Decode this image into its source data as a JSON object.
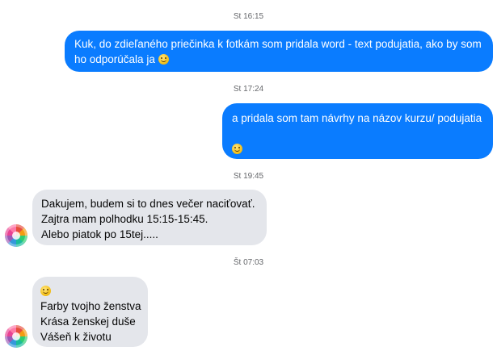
{
  "conversation": {
    "messages": [
      {
        "timestamp": "St 16:15",
        "direction": "outgoing",
        "lines": [
          "Kuk, do zdieľaného priečinka k fotkám som pridala word - text podujatia, ako by som",
          "ho odporúčala ja"
        ],
        "emoji": "slightly-smiling-face-icon"
      },
      {
        "timestamp": "St 17:24",
        "direction": "outgoing",
        "lines": [
          "a pridala som tam návrhy na názov kurzu/ podujatia"
        ],
        "emoji": "slightly-smiling-face-icon"
      },
      {
        "timestamp": "St 19:45",
        "direction": "incoming",
        "lines": [
          "Dakujem, budem si to dnes večer  naciťovať.",
          "Zajtra mam polhodku 15:15-15:45.",
          "Alebo piatok po 15tej....."
        ]
      },
      {
        "timestamp": "Št 07:03",
        "direction": "incoming",
        "emoji": "slightly-smiling-face-icon",
        "lines": [
          "Farby tvojho ženstva",
          "Krása ženskej duše",
          "Vášeň k životu"
        ]
      }
    ]
  },
  "colors": {
    "outgoing_bubble": "#0a7cff",
    "incoming_bubble": "#e4e6eb",
    "timestamp_text": "#65676b"
  },
  "icons": {
    "emoji": "slightly-smiling-face-icon",
    "contact_avatar": "avatar-icon"
  }
}
